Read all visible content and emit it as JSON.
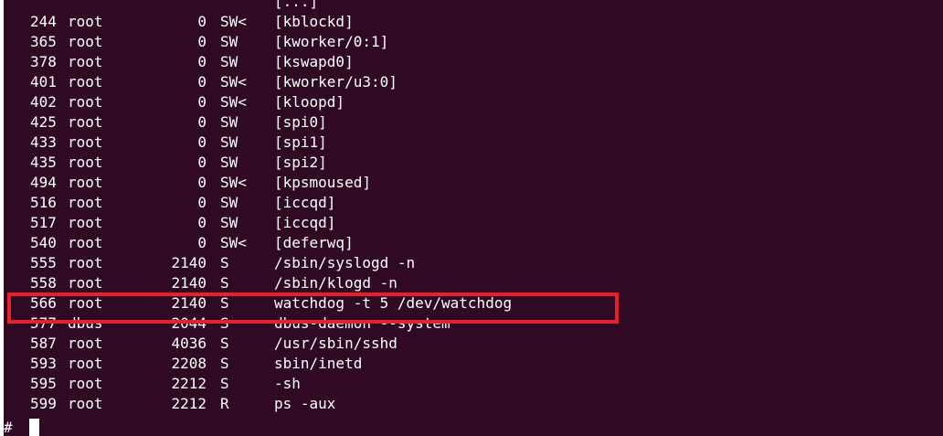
{
  "terminal": {
    "background": "#300a24",
    "foreground": "#ffffff",
    "prompt": "#",
    "highlight_color": "#e8202a"
  },
  "processes": [
    {
      "pid": "",
      "user": "",
      "vsz": "",
      "stat": "",
      "command": "[...]"
    },
    {
      "pid": "244",
      "user": "root",
      "vsz": "0",
      "stat": "SW<",
      "command": "[kblockd]"
    },
    {
      "pid": "365",
      "user": "root",
      "vsz": "0",
      "stat": "SW",
      "command": "[kworker/0:1]"
    },
    {
      "pid": "378",
      "user": "root",
      "vsz": "0",
      "stat": "SW",
      "command": "[kswapd0]"
    },
    {
      "pid": "401",
      "user": "root",
      "vsz": "0",
      "stat": "SW<",
      "command": "[kworker/u3:0]"
    },
    {
      "pid": "402",
      "user": "root",
      "vsz": "0",
      "stat": "SW<",
      "command": "[kloopd]"
    },
    {
      "pid": "425",
      "user": "root",
      "vsz": "0",
      "stat": "SW",
      "command": "[spi0]"
    },
    {
      "pid": "433",
      "user": "root",
      "vsz": "0",
      "stat": "SW",
      "command": "[spi1]"
    },
    {
      "pid": "435",
      "user": "root",
      "vsz": "0",
      "stat": "SW",
      "command": "[spi2]"
    },
    {
      "pid": "494",
      "user": "root",
      "vsz": "0",
      "stat": "SW<",
      "command": "[kpsmoused]"
    },
    {
      "pid": "516",
      "user": "root",
      "vsz": "0",
      "stat": "SW",
      "command": "[iccqd]"
    },
    {
      "pid": "517",
      "user": "root",
      "vsz": "0",
      "stat": "SW",
      "command": "[iccqd]"
    },
    {
      "pid": "540",
      "user": "root",
      "vsz": "0",
      "stat": "SW<",
      "command": "[deferwq]"
    },
    {
      "pid": "555",
      "user": "root",
      "vsz": "2140",
      "stat": "S",
      "command": "/sbin/syslogd -n"
    },
    {
      "pid": "558",
      "user": "root",
      "vsz": "2140",
      "stat": "S",
      "command": "/sbin/klogd -n"
    },
    {
      "pid": "566",
      "user": "root",
      "vsz": "2140",
      "stat": "S",
      "command": "watchdog -t 5 /dev/watchdog"
    },
    {
      "pid": "577",
      "user": "dbus",
      "vsz": "2044",
      "stat": "S",
      "command": "dbus-daemon --system"
    },
    {
      "pid": "587",
      "user": "root",
      "vsz": "4036",
      "stat": "S",
      "command": "/usr/sbin/sshd"
    },
    {
      "pid": "593",
      "user": "root",
      "vsz": "2208",
      "stat": "S",
      "command": "sbin/inetd"
    },
    {
      "pid": "595",
      "user": "root",
      "vsz": "2212",
      "stat": "S",
      "command": "-sh"
    },
    {
      "pid": "599",
      "user": "root",
      "vsz": "2212",
      "stat": "R",
      "command": "ps -aux"
    }
  ]
}
